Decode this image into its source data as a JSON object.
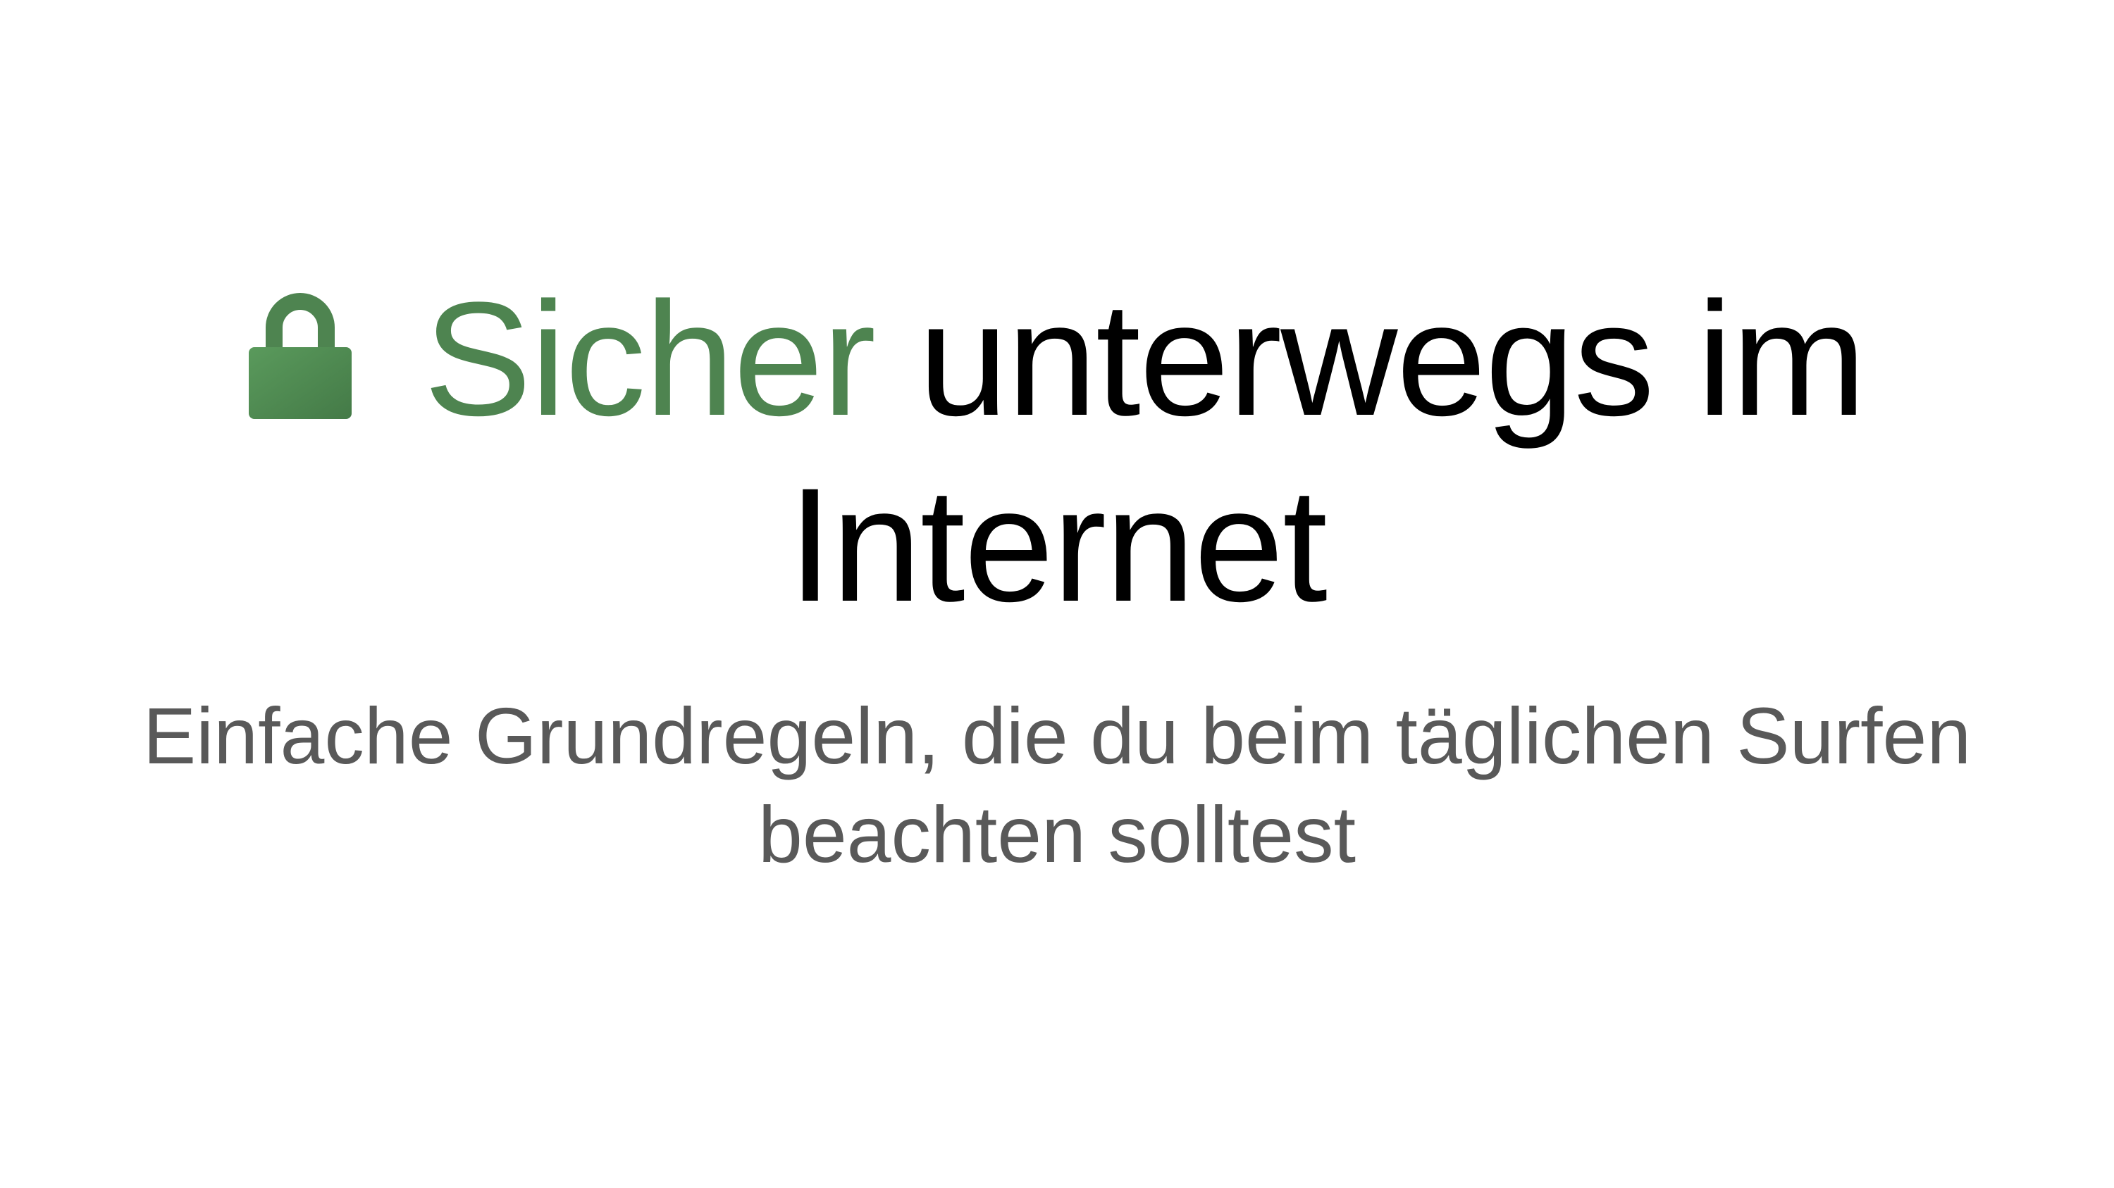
{
  "slide": {
    "title": {
      "icon": "lock-icon",
      "accent_text": "Sicher",
      "line1_rest": " unterwegs im",
      "line2": "Internet"
    },
    "subtitle": {
      "line1": "Einfache Grundregeln, die du beim täglichen Surfen",
      "line2": "beachten solltest"
    }
  },
  "colors": {
    "accent": "#4e8450",
    "title_text": "#000000",
    "subtitle_text": "#595959",
    "background": "#ffffff"
  }
}
